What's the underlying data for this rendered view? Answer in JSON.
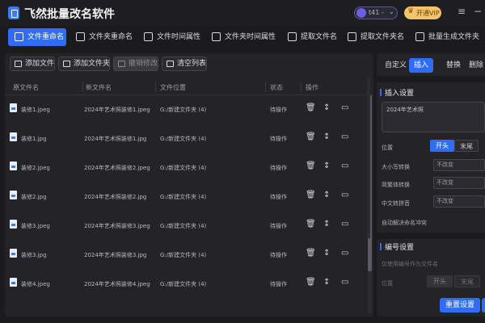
{
  "app": {
    "title": "飞然批量改名软件",
    "user_name": "t41 -",
    "vip_label": "开通VIP"
  },
  "colors": {
    "accent": "#2f6df6",
    "vip": "#f3c46a",
    "background": "#1b1b1f",
    "panel": "#232328"
  },
  "tabs": [
    {
      "label": "文件重命名",
      "active": true
    },
    {
      "label": "文件夹重命名"
    },
    {
      "label": "文件时间属性"
    },
    {
      "label": "文件夹时间属性"
    },
    {
      "label": "提取文件名"
    },
    {
      "label": "提取文件夹名"
    },
    {
      "label": "批量生成文件夹"
    }
  ],
  "toolbar": {
    "add_file": "添加文件",
    "add_folder": "添加文件夹",
    "undo": "撤销修改",
    "clear": "清空列表"
  },
  "table": {
    "headers": [
      "原文件名",
      "新文件名",
      "文件位置",
      "状态",
      "操作"
    ],
    "rows": [
      {
        "orig": "装修1.jpeg",
        "new": "2024年艺术照装修1.jpeg",
        "path": "G:/新建文件夹 (4)",
        "status": "待操作"
      },
      {
        "orig": "装修1.jpg",
        "new": "2024年艺术照装修1.jpg",
        "path": "G:/新建文件夹 (4)",
        "status": "待操作"
      },
      {
        "orig": "装修2.jpeg",
        "new": "2024年艺术照装修2.jpeg",
        "path": "G:/新建文件夹 (4)",
        "status": "待操作"
      },
      {
        "orig": "装修2.jpg",
        "new": "2024年艺术照装修2.jpg",
        "path": "G:/新建文件夹 (4)",
        "status": "待操作"
      },
      {
        "orig": "装修3.jpeg",
        "new": "2024年艺术照装修3.jpeg",
        "path": "G:/新建文件夹 (4)",
        "status": "待操作"
      },
      {
        "orig": "装修3.jpg",
        "new": "2024年艺术照装修3.jpg",
        "path": "G:/新建文件夹 (4)",
        "status": "待操作"
      },
      {
        "orig": "装修4.jpeg",
        "new": "2024年艺术照装修4.jpeg",
        "path": "G:/新建文件夹 (4)",
        "status": "待操作"
      }
    ]
  },
  "right": {
    "tabs": [
      {
        "label": "自定义"
      },
      {
        "label": "插入",
        "active": true
      },
      {
        "label": "替换"
      },
      {
        "label": "删除"
      }
    ],
    "insert_title": "插入设置",
    "insert_text": "2024年艺术照",
    "position_label": "位置",
    "pos_head": "开头",
    "pos_tail": "末尾",
    "case_label": "大小写转换",
    "case_value": "不改变",
    "trad_label": "简繁体转换",
    "trad_value": "不改变",
    "pinyin_label": "中文转拼音",
    "pinyin_value": "不改变",
    "auto_label": "自动解决命名冲突",
    "number_title": "编号设置",
    "number_hint": "仅使用编号作为文件名",
    "num_position_label": "位置",
    "num_head": "开头",
    "num_tail": "末尾",
    "reset_label": "重置设置"
  }
}
